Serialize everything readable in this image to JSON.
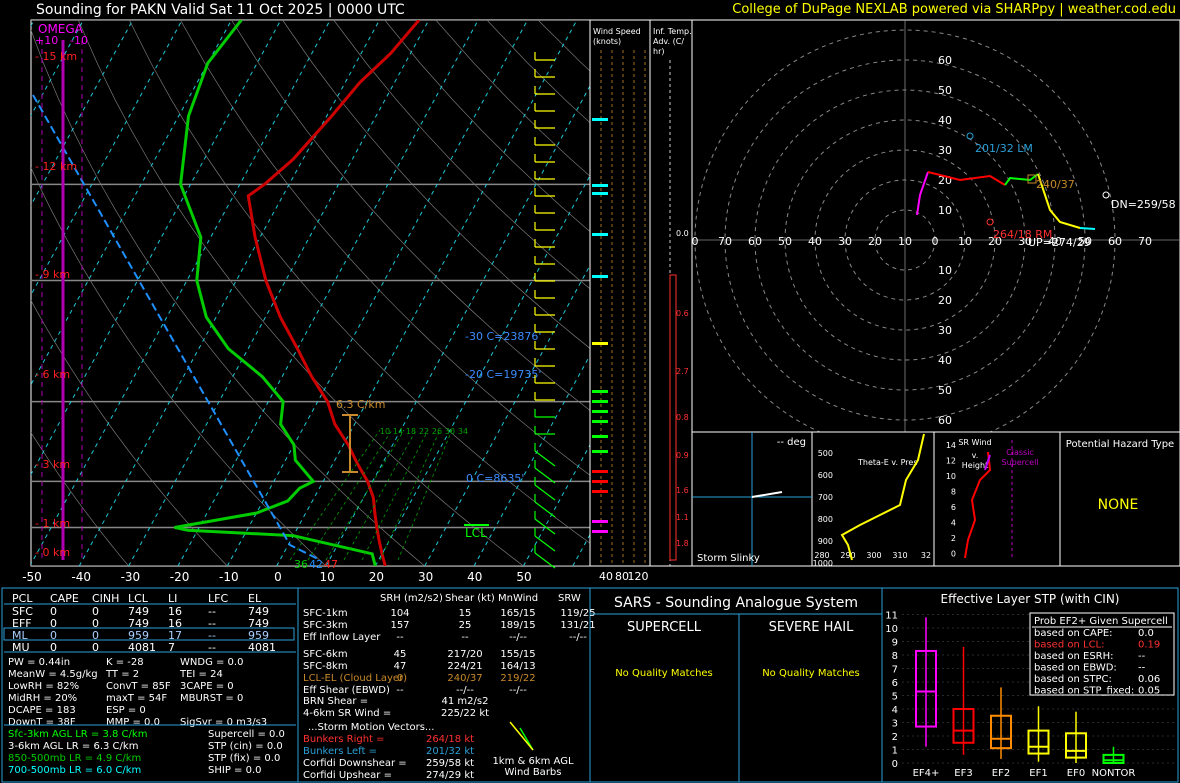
{
  "header": {
    "title": "Sounding for PAKN Valid  Sat 11 Oct 2025 | 0000 UTC",
    "credit": "College of DuPage NEXLAB powered via SHARPpy | weather.cod.edu"
  },
  "skewt": {
    "omega_label": "OMEGA",
    "omega_ticks": [
      "+10",
      "-10"
    ],
    "pressure_ticks": [
      "100",
      "200",
      "300",
      "500",
      "700",
      "850",
      "1000"
    ],
    "temp_ticks": [
      "-50",
      "-40",
      "-30",
      "-20",
      "-10",
      "0",
      "10",
      "20",
      "30",
      "40",
      "50"
    ],
    "height_labels": [
      "15 km",
      "12 km",
      "9 km",
      "6 km",
      "3 km",
      "1 km",
      "0 km"
    ],
    "isotherm_labels": [
      "-30 C=23876'",
      "-20 C=19735'",
      "0 C=8635'"
    ],
    "lapse_label": "6.3 C/km",
    "mixing_labels": [
      "10",
      "14",
      "18",
      "22",
      "26",
      "30",
      "34"
    ],
    "lcl_label": "LCL",
    "surface_values": [
      "36",
      "42",
      "47"
    ]
  },
  "wind_speed": {
    "title": "Wind Speed (knots)",
    "ticks": [
      "40",
      "80",
      "120"
    ]
  },
  "inferred_temp": {
    "title": "Inf. Temp. Adv. (C/hr)",
    "values": [
      "0.0",
      "0.6",
      "2.7",
      "0.8",
      "0.9",
      "1.6",
      "1.1",
      "1.8"
    ]
  },
  "hodograph": {
    "ring_labels": [
      "60",
      "50",
      "40",
      "30",
      "20",
      "10"
    ],
    "axis_labels": [
      "0",
      "70",
      "60",
      "50",
      "40",
      "30",
      "20",
      "10",
      "0",
      "10",
      "20",
      "30",
      "40",
      "50",
      "60",
      "70"
    ],
    "storm_labels": {
      "lm": "201/32 LM",
      "rm": "264/18 RM",
      "mean": "240/37",
      "dn": "DN=259/58",
      "up": "UP=274/29"
    }
  },
  "insets": {
    "slinky_deg": "-- deg",
    "slinky_label": "Storm Slinky",
    "theta_label": "Theta-E v. Pres",
    "theta_pres": [
      "500",
      "600",
      "700",
      "800",
      "900",
      "1000"
    ],
    "theta_temp": [
      "280",
      "290",
      "300",
      "310",
      "32"
    ],
    "srwind_label": "SR Wind v. Height",
    "srwind_heights": [
      "14",
      "12",
      "10",
      "8",
      "6",
      "4",
      "2",
      "0"
    ],
    "classic_label": "Classic Supercell",
    "hazard_title": "Potential Hazard Type",
    "hazard_value": "NONE"
  },
  "parcels": {
    "headers": [
      "PCL",
      "CAPE",
      "CINH",
      "LCL",
      "LI",
      "LFC",
      "EL"
    ],
    "rows": [
      [
        "SFC",
        "0",
        "0",
        "749",
        "16",
        "--",
        "749"
      ],
      [
        "EFF",
        "0",
        "0",
        "749",
        "16",
        "--",
        "749"
      ],
      [
        "ML",
        "0",
        "0",
        "959",
        "17",
        "--",
        "959"
      ],
      [
        "MU",
        "0",
        "0",
        "4081",
        "7",
        "--",
        "4081"
      ]
    ],
    "indices": [
      [
        "PW = 0.44in",
        "K = -28",
        "WNDG = 0.0"
      ],
      [
        "MeanW = 4.5g/kg",
        "TT = 2",
        "TEI = 24"
      ],
      [
        "LowRH = 82%",
        "ConvT = 85F",
        "3CAPE = 0"
      ],
      [
        "MidRH = 20%",
        "maxT = 54F",
        "MBURST = 0"
      ],
      [
        "DCAPE = 183",
        "ESP = 0",
        ""
      ],
      [
        "DownT = 38F",
        "MMP = 0.0",
        "SigSvr = 0 m3/s3"
      ]
    ],
    "lapse_rates": [
      "Sfc-3km AGL LR = 3.8 C/km",
      "3-6km AGL LR = 6.3 C/km",
      "850-500mb LR = 4.9 C/km",
      "700-500mb LR = 6.0 C/km"
    ],
    "composites": [
      "Supercell = 0.0",
      "STP (cin) = 0.0",
      "STP (fix) = 0.0",
      "SHIP = 0.0"
    ]
  },
  "kinematics": {
    "headers": [
      "",
      "SRH (m2/s2)",
      "Shear (kt)",
      "MnWind",
      "SRW"
    ],
    "rows": [
      [
        "SFC-1km",
        "104",
        "15",
        "165/15",
        "119/25"
      ],
      [
        "SFC-3km",
        "157",
        "25",
        "189/15",
        "131/21"
      ],
      [
        "Eff Inflow Layer",
        "--",
        "--",
        "--/--",
        "--/--"
      ],
      [
        "SFC-6km",
        "45",
        "217/20",
        "155/15",
        ""
      ],
      [
        "SFC-8km",
        "47",
        "224/21",
        "164/13",
        ""
      ],
      [
        "LCL-EL (Cloud Layer)",
        "0",
        "240/37",
        "219/22",
        ""
      ],
      [
        "Eff Shear (EBWD)",
        "--",
        "--/--",
        "--/--",
        ""
      ]
    ],
    "brn": "BRN Shear =",
    "brn_val": "41 m2/s2",
    "srwind": "4-6km SR Wind =",
    "srwind_val": "225/22 kt",
    "storm_title": "...Storm Motion Vectors...",
    "storm": [
      [
        "Bunkers Right =",
        "264/18 kt"
      ],
      [
        "Bunkers Left =",
        "201/32 kt"
      ],
      [
        "Corfidi Downshear =",
        "259/58 kt"
      ],
      [
        "Corfidi Upshear =",
        "274/29 kt"
      ]
    ],
    "barbs_label": "1km & 6km AGL Wind Barbs"
  },
  "sars": {
    "title": "SARS - Sounding Analogue System",
    "supercell": "SUPERCELL",
    "hail": "SEVERE HAIL",
    "no_match": "No Quality Matches"
  },
  "stp": {
    "title": "Effective Layer STP (with CIN)",
    "legend_title": "Prob EF2+ Given Supercell",
    "legend": [
      [
        "based on CAPE:",
        "0.0"
      ],
      [
        "based on LCL:",
        "0.19"
      ],
      [
        "based on ESRH:",
        "--"
      ],
      [
        "based on EBWD:",
        "--"
      ],
      [
        "based on STPC:",
        "0.06"
      ],
      [
        "based on STP_fixed:",
        "0.05"
      ]
    ],
    "colors": {
      "ef4": "#ff00ff",
      "ef3": "#ff0000",
      "ef2": "#ff8c00",
      "ef1": "#ffff00",
      "ef0": "#ffff00",
      "nontor": "#00ff00"
    }
  },
  "chart_data": [
    {
      "type": "line",
      "title": "Sounding for PAKN Valid  Sat 11 Oct 2025 | 0000 UTC",
      "xlabel": "",
      "ylabel": "",
      "xlim": [
        -50,
        50
      ],
      "ylim": [
        1000,
        100
      ],
      "y_scale": "log",
      "series": [
        {
          "name": "",
          "color": "#cc0000",
          "points": [
            [
              12,
              1000
            ],
            [
              10,
              950
            ],
            [
              8,
              900
            ],
            [
              6,
              850
            ],
            [
              4,
              800
            ],
            [
              2,
              750
            ],
            [
              -1,
              700
            ],
            [
              -5,
              650
            ],
            [
              -9,
              600
            ],
            [
              -14,
              550
            ],
            [
              -18,
              500
            ],
            [
              -24,
              450
            ],
            [
              -30,
              400
            ],
            [
              -37,
              350
            ],
            [
              -44,
              300
            ],
            [
              -51,
              250
            ],
            [
              -57,
              210
            ],
            [
              -55,
              200
            ],
            [
              -52,
              180
            ],
            [
              -49,
              150
            ],
            [
              -47,
              130
            ],
            [
              -44,
              115
            ],
            [
              -42,
              100
            ]
          ]
        },
        {
          "name": "",
          "color": "#00cc00",
          "points": [
            [
              10,
              1000
            ],
            [
              8,
              950
            ],
            [
              -10,
              880
            ],
            [
              -32,
              860
            ],
            [
              -35,
              850
            ],
            [
              -20,
              800
            ],
            [
              -15,
              760
            ],
            [
              -14,
              720
            ],
            [
              -12,
              700
            ],
            [
              -18,
              640
            ],
            [
              -20,
              600
            ],
            [
              -25,
              550
            ],
            [
              -27,
              500
            ],
            [
              -34,
              450
            ],
            [
              -44,
              400
            ],
            [
              -52,
              350
            ],
            [
              -58,
              300
            ],
            [
              -62,
              250
            ],
            [
              -72,
              200
            ],
            [
              -78,
              150
            ],
            [
              -80,
              120
            ],
            [
              -78,
              100
            ]
          ]
        }
      ]
    },
    {
      "type": "bar",
      "title": "Effective Layer STP (with CIN)",
      "categories": [
        "EF4+",
        "EF3",
        "EF2",
        "EF1",
        "EF0",
        "NONTOR"
      ],
      "ylim": [
        0,
        11
      ],
      "series": [
        {
          "name": "",
          "box": [
            [
              1.2,
              2.7,
              5.3,
              8.3,
              10.8
            ],
            [
              0.6,
              1.5,
              2.4,
              4.0,
              8.6
            ],
            [
              0.3,
              1.1,
              1.8,
              3.5,
              5.6
            ],
            [
              0.1,
              0.7,
              1.2,
              2.4,
              4.2
            ],
            [
              0,
              0.4,
              0.9,
              2.2,
              3.8
            ],
            [
              0,
              0,
              0.2,
              0.6,
              1.2
            ]
          ]
        }
      ]
    }
  ]
}
